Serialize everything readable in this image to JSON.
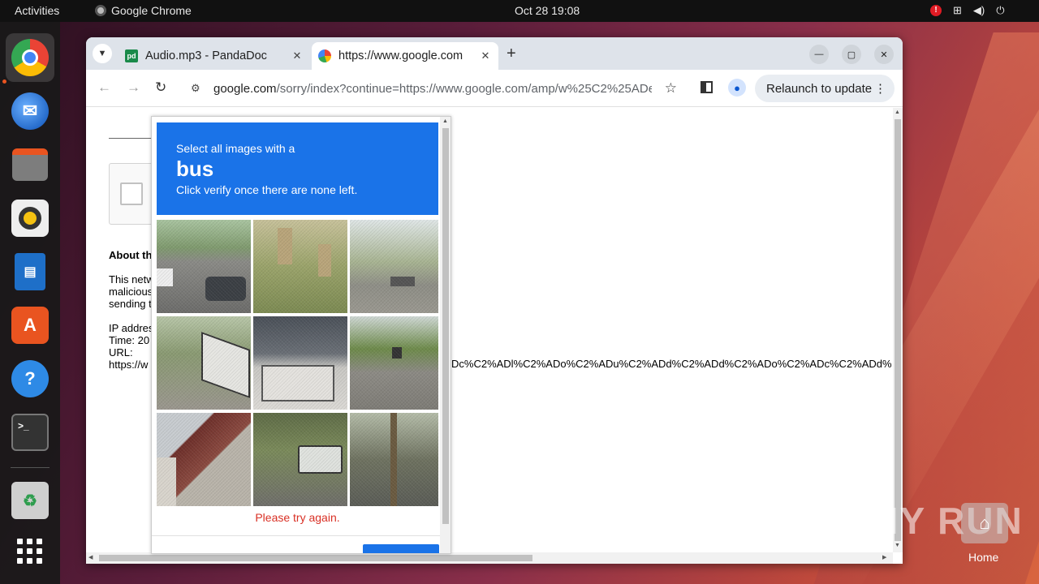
{
  "topbar": {
    "activities": "Activities",
    "app": "Google Chrome",
    "datetime": "Oct 28  19:08"
  },
  "dock": {
    "items": [
      "chrome-icon",
      "thunderbird-icon",
      "files-icon",
      "rhythmbox-icon",
      "writer-icon",
      "app-center-icon",
      "help-icon",
      "terminal-icon",
      "trash-icon",
      "show-apps-icon"
    ]
  },
  "browser": {
    "tabs": [
      {
        "title": "Audio.mp3 - PandaDoc",
        "favicon": "pandadoc-icon"
      },
      {
        "title": "https://www.google.com",
        "favicon": "google-icon"
      }
    ],
    "url_host": "google.com",
    "url_path": "/sorry/index?continue=https://www.google.com/amp/w%25C2%25ADe...",
    "relaunch": "Relaunch to update"
  },
  "page": {
    "about": "About th",
    "para1": [
      "This netw",
      "malicious",
      "sending t"
    ],
    "info": [
      "IP addres",
      "Time: 20",
      "URL:",
      "https://w"
    ],
    "url_tail": "Dc%C2%ADl%C2%ADo%C2%ADu%C2%ADd%C2%ADd%C2%ADo%C2%ADc%C2%ADd%"
  },
  "captcha": {
    "prompt": "Select all images with a",
    "target": "bus",
    "instruction": "Click verify once there are none left.",
    "error": "Please try again.",
    "accent": "#1a73e8",
    "error_color": "#d93025"
  },
  "watermark": "ANY RUN",
  "desktop": {
    "home_label": "Home"
  }
}
